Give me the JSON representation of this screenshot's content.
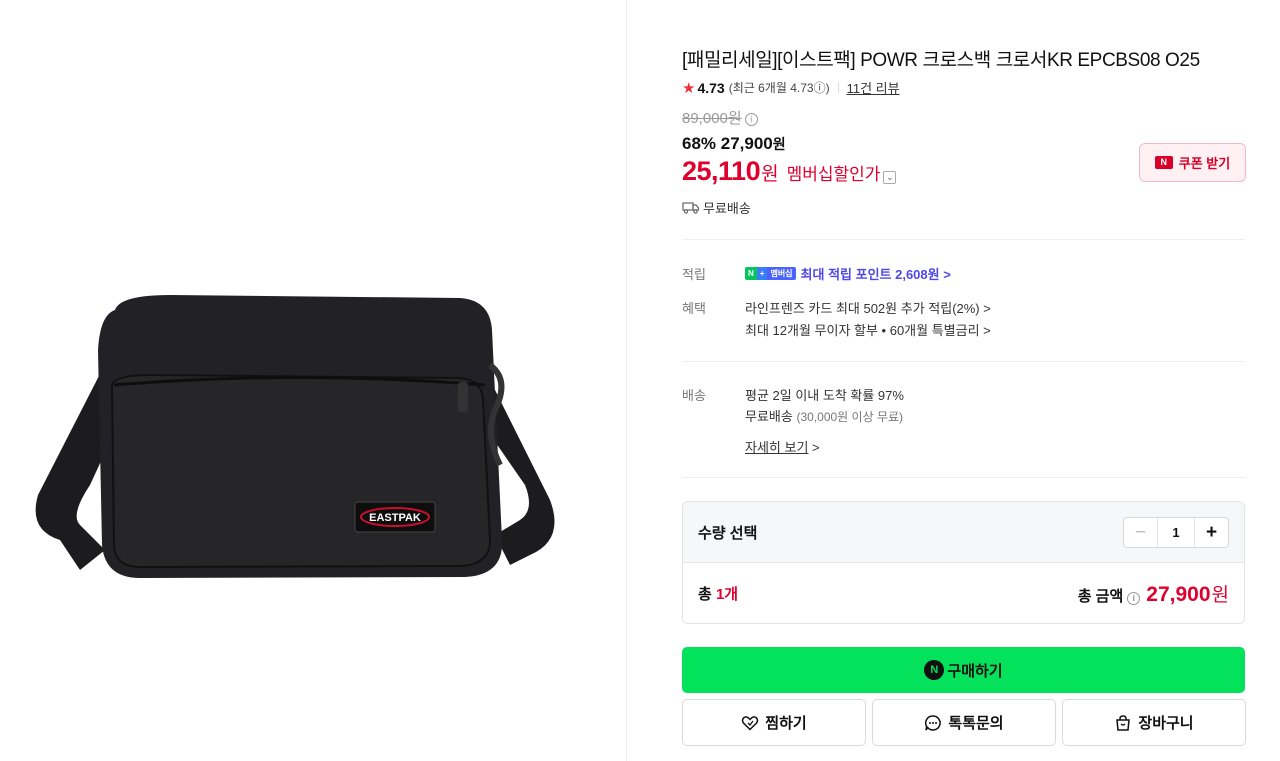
{
  "product": {
    "title": "[패밀리세일][이스트팩] POWR 크로스백 크로서KR EPCBS08 O25",
    "image_alt": "Eastpak black crossbody bag",
    "brand_patch": "EASTPAK",
    "rating": "4.73",
    "rating_recent": "(최근 6개월 4.73",
    "rating_recent_info": "ⓘ",
    "rating_recent_close": ")",
    "review_count": "11건 리뷰",
    "original_price": "89,000원",
    "discount_percent": "68%",
    "sale_price": "27,900",
    "sale_price_unit": "원",
    "member_price": "25,110",
    "member_price_unit": "원",
    "member_label": "멤버십할인가",
    "coupon_label": "쿠폰 받기",
    "free_shipping": "무료배송"
  },
  "benefits": {
    "point_label": "적립",
    "point_badge_n": "N",
    "point_badge_plus": "+",
    "point_badge_member": "멤버십",
    "point_text": "최대 적립 포인트 2,608원 >",
    "benefit_label": "혜택",
    "benefit_line1": "라인프렌즈 카드 최대 502원 추가 적립(2%) >",
    "benefit_line2": "최대 12개월 무이자 할부 • 60개월 특별금리 >"
  },
  "delivery": {
    "label": "배송",
    "line1": "평균 2일 이내 도착 확률 97%",
    "line2_main": "무료배송",
    "line2_sub": "(30,000원 이상 무료)",
    "details_link": "자세히 보기",
    "details_arrow": ">"
  },
  "quantity": {
    "label": "수량 선택",
    "minus": "−",
    "value": "1",
    "plus": "+",
    "total_prefix": "총 ",
    "total_count": "1개",
    "total_amount_label": "총 금액",
    "total_amount": "27,900",
    "total_amount_unit": "원"
  },
  "actions": {
    "buy_icon": "N",
    "buy_label": "구매하기",
    "wish_label": "찜하기",
    "talk_label": "톡톡문의",
    "cart_label": "장바구니"
  },
  "colors": {
    "accent_red": "#e0002d",
    "buy_green": "#03e25a",
    "point_purple": "#4f48e8"
  },
  "icons": {
    "star": "star-icon",
    "truck": "truck-icon",
    "heart": "heart-icon",
    "chat": "chat-icon",
    "bag": "shopping-bag-icon"
  }
}
